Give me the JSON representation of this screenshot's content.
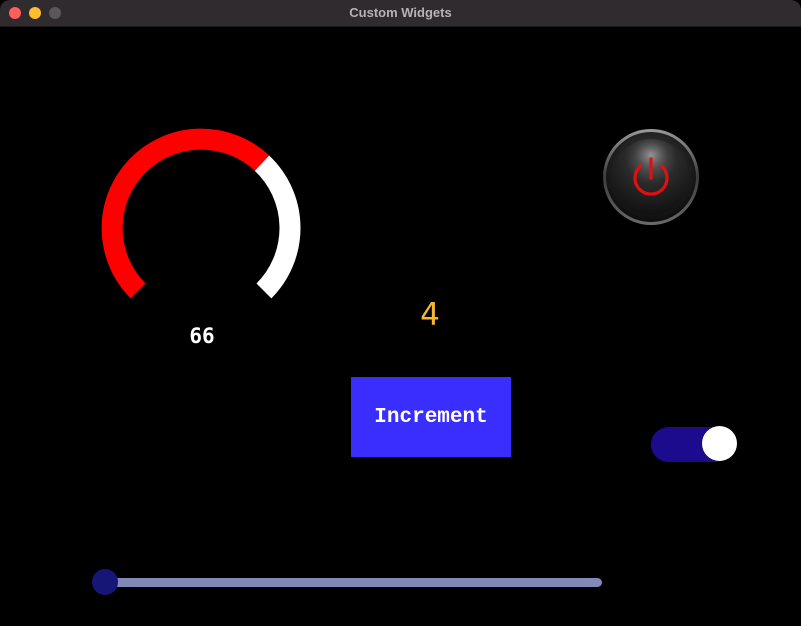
{
  "window": {
    "title": "Custom Widgets"
  },
  "gauge": {
    "value": 66,
    "value_label": "66",
    "filled_color": "#ff0000",
    "remaining_color": "#ffffff"
  },
  "power_button": {
    "icon": "power-icon",
    "icon_color": "#e01010"
  },
  "counter": {
    "value": "4",
    "color": "#f7b733"
  },
  "increment_button": {
    "label": "Increment",
    "color": "#3a2eff"
  },
  "toggle": {
    "state": "on",
    "track_color": "#1c0b8c",
    "knob_color": "#ffffff"
  },
  "slider": {
    "value": 0,
    "track_color": "#8089b8",
    "thumb_color": "#161678"
  }
}
